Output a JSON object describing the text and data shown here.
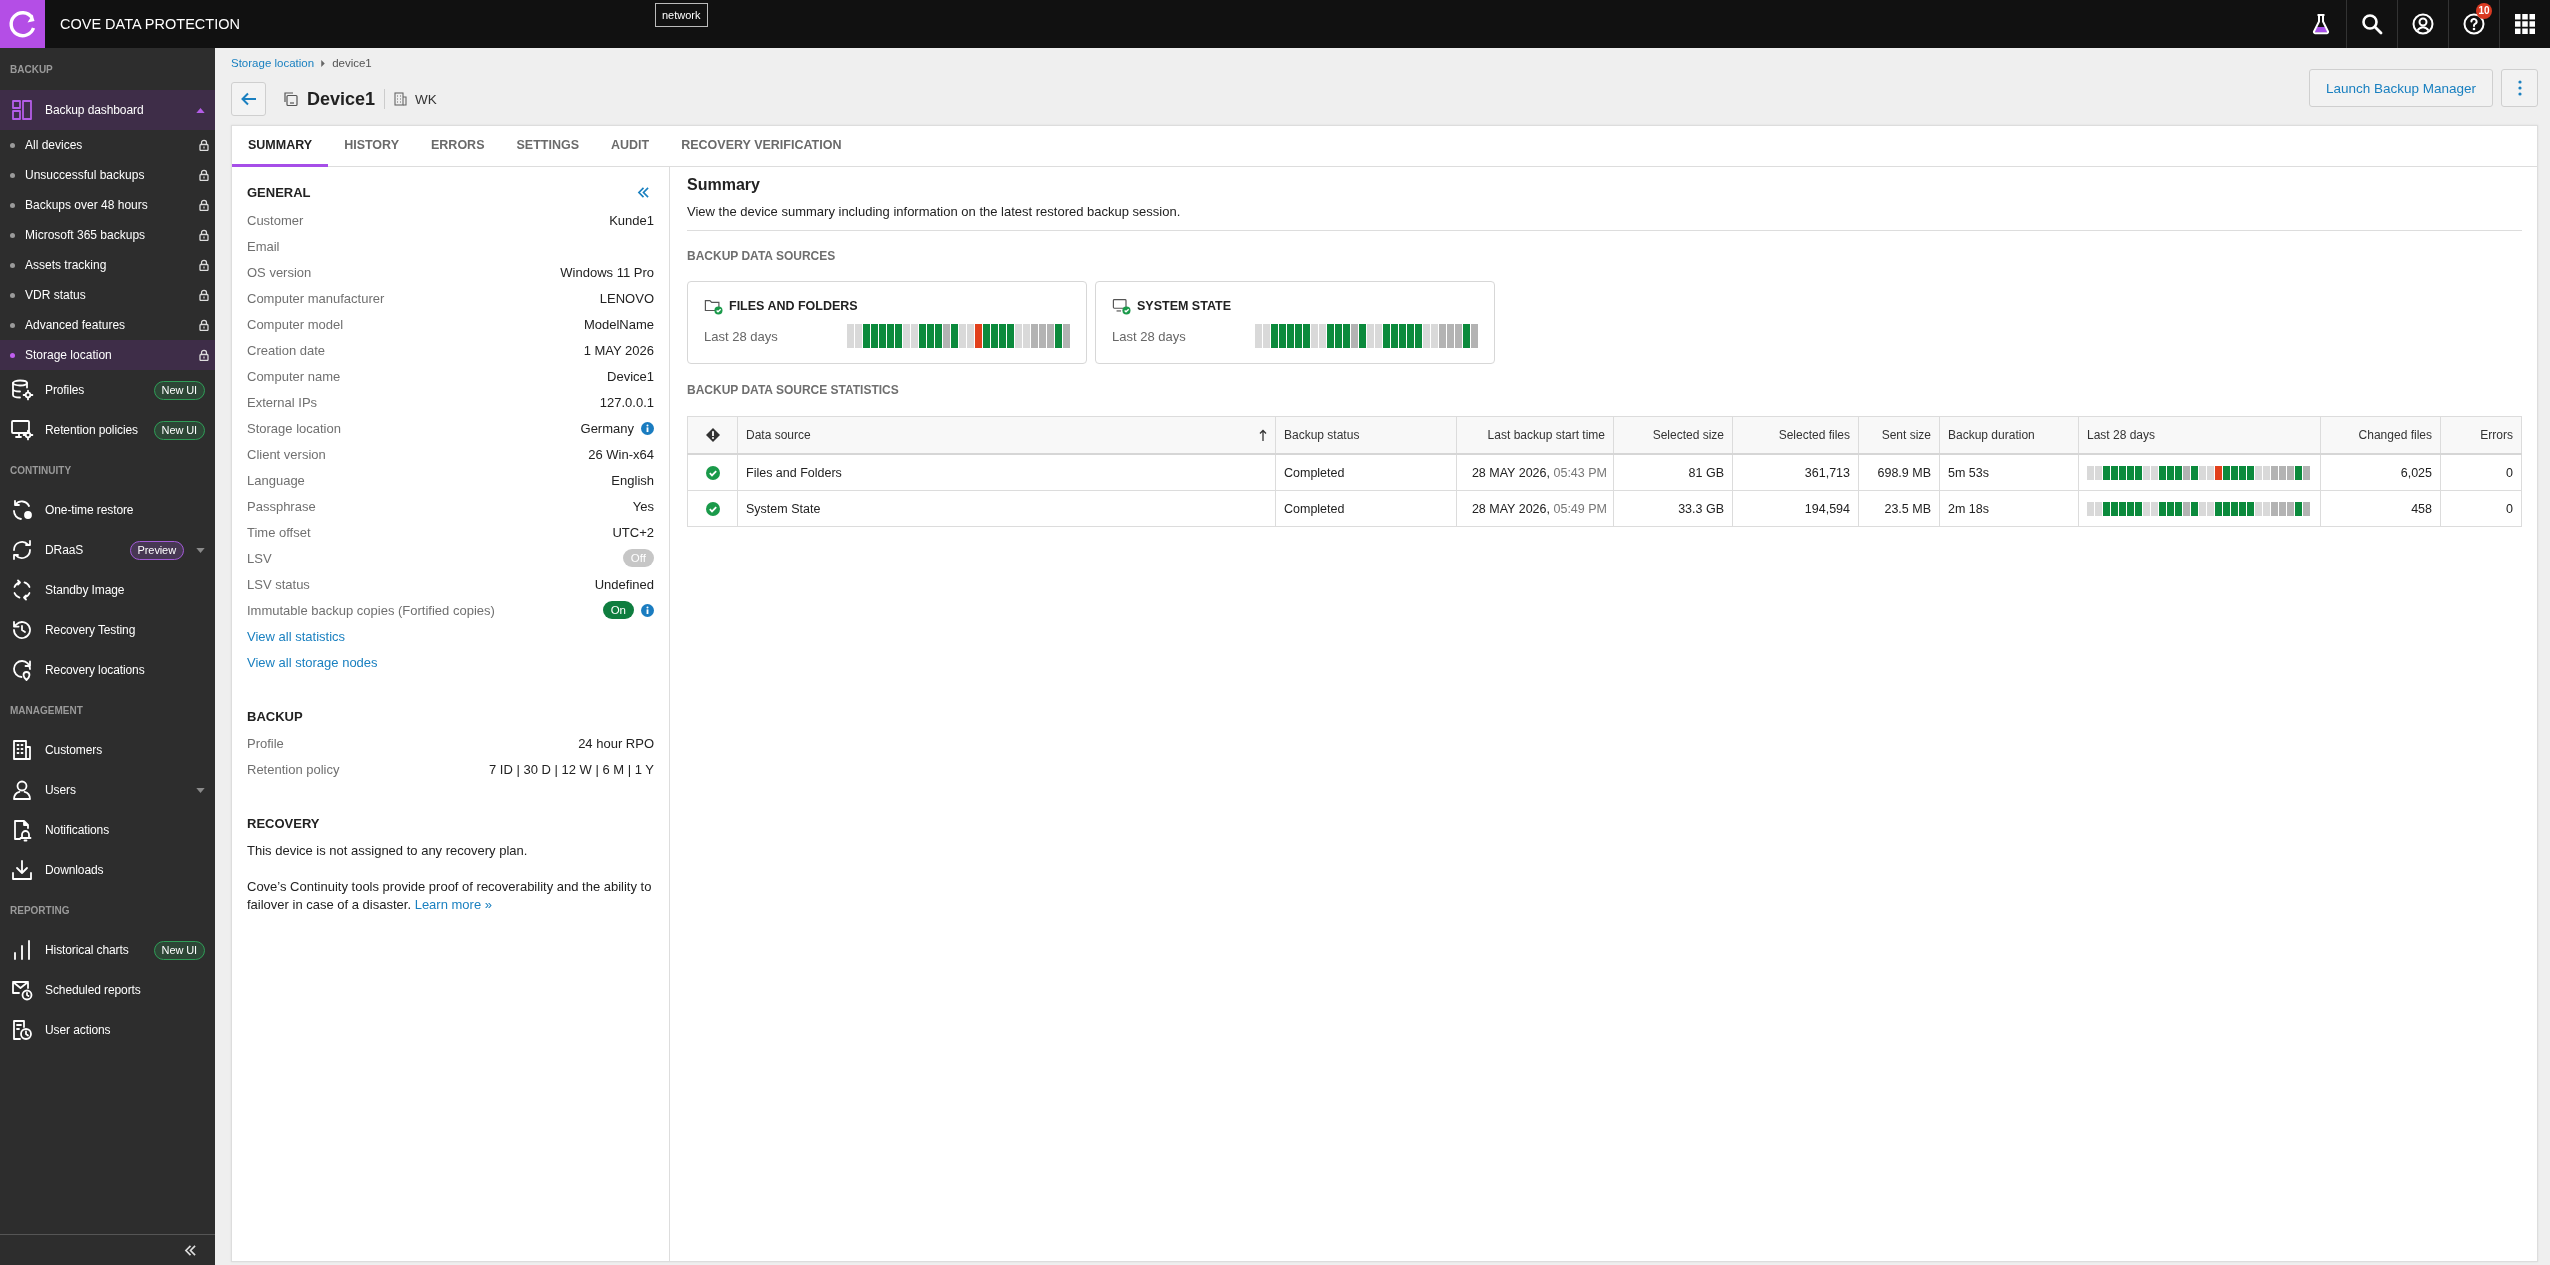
{
  "top_bar": {
    "title": "COVE DATA PROTECTION",
    "environment": "network",
    "help_badge": "10"
  },
  "sidebar": {
    "sections": [
      {
        "heading": "BACKUP",
        "items": [
          {
            "label": "Backup dashboard",
            "selected": true,
            "expanded": true,
            "children": [
              {
                "label": "All devices",
                "selected": false,
                "locked": true
              },
              {
                "label": "Unsuccessful backups",
                "selected": false,
                "locked": true
              },
              {
                "label": "Backups over 48 hours",
                "selected": false,
                "locked": true
              },
              {
                "label": "Microsoft 365 backups",
                "selected": false,
                "locked": true
              },
              {
                "label": "Assets tracking",
                "selected": false,
                "locked": true
              },
              {
                "label": "VDR status",
                "selected": false,
                "locked": true
              },
              {
                "label": "Advanced features",
                "selected": false,
                "locked": true
              },
              {
                "label": "Storage location",
                "selected": true,
                "locked": true
              }
            ]
          },
          {
            "label": "Profiles",
            "selected": false,
            "badge": {
              "label": "New UI",
              "color": "#2f9e57"
            }
          },
          {
            "label": "Retention policies",
            "selected": false,
            "badge": {
              "label": "New UI",
              "color": "#2f9e57"
            }
          }
        ]
      },
      {
        "heading": "CONTINUITY",
        "items": [
          {
            "label": "One-time restore",
            "selected": false
          },
          {
            "label": "DRaaS",
            "selected": false,
            "expanded": false,
            "badge": {
              "label": "Preview",
              "color": "#a35bd8"
            }
          },
          {
            "label": "Standby Image",
            "selected": false
          },
          {
            "label": "Recovery Testing",
            "selected": false
          },
          {
            "label": "Recovery locations",
            "selected": false
          }
        ]
      },
      {
        "heading": "MANAGEMENT",
        "items": [
          {
            "label": "Customers",
            "selected": false
          },
          {
            "label": "Users",
            "selected": false,
            "expanded": false
          },
          {
            "label": "Notifications",
            "selected": false
          },
          {
            "label": "Downloads",
            "selected": false
          }
        ]
      },
      {
        "heading": "REPORTING",
        "items": [
          {
            "label": "Historical charts",
            "selected": false,
            "badge": {
              "label": "New UI",
              "color": "#2f9e57"
            }
          },
          {
            "label": "Scheduled reports",
            "selected": false
          },
          {
            "label": "User actions",
            "selected": false
          }
        ]
      }
    ]
  },
  "page_header": {
    "breadcrumb": {
      "parent": "Storage location",
      "current": "device1"
    },
    "device_name": "Device1",
    "company": "WK",
    "launch_button": "Launch Backup Manager"
  },
  "tabs": [
    {
      "label": "SUMMARY",
      "selected": true
    },
    {
      "label": "HISTORY",
      "selected": false
    },
    {
      "label": "ERRORS",
      "selected": false
    },
    {
      "label": "SETTINGS",
      "selected": false
    },
    {
      "label": "AUDIT",
      "selected": false
    },
    {
      "label": "RECOVERY VERIFICATION",
      "selected": false
    }
  ],
  "general": {
    "heading": "GENERAL",
    "rows": [
      {
        "kind": "text",
        "label": "Customer",
        "value": "Kunde1"
      },
      {
        "kind": "text",
        "label": "Email"
      },
      {
        "kind": "text",
        "label": "OS version",
        "value": "Windows 11 Pro"
      },
      {
        "kind": "text",
        "label": "Computer manufacturer",
        "value": "LENOVO"
      },
      {
        "kind": "text",
        "label": "Computer model",
        "value": "ModelName"
      },
      {
        "kind": "text",
        "label": "Creation date",
        "value": "1 MAY 2026"
      },
      {
        "kind": "text",
        "label": "Computer name",
        "value": "Device1"
      },
      {
        "kind": "text",
        "label": "External IPs",
        "value": "127.0.0.1"
      },
      {
        "kind": "text",
        "label": "Storage location",
        "value": "Germany",
        "info": true
      },
      {
        "kind": "text",
        "label": "Client version",
        "value": "26 Win-x64"
      },
      {
        "kind": "text",
        "label": "Language",
        "value": "English"
      },
      {
        "kind": "text",
        "label": "Passphrase",
        "value": "Yes"
      },
      {
        "kind": "text",
        "label": "Time offset",
        "value": "UTC+2"
      },
      {
        "kind": "toggle",
        "label": "LSV",
        "value": "Off",
        "on": false
      },
      {
        "kind": "text",
        "label": "LSV status",
        "value": "Undefined"
      },
      {
        "kind": "toggle",
        "label": "Immutable backup copies (Fortified copies)",
        "value": "On",
        "on": true,
        "info": true
      }
    ],
    "links": [
      "View all statistics",
      "View all storage nodes"
    ]
  },
  "backup": {
    "heading": "BACKUP",
    "rows": [
      {
        "label": "Profile",
        "value": "24 hour RPO"
      },
      {
        "label": "Retention policy",
        "value": "7 ID | 30 D | 12 W | 6 M | 1 Y"
      }
    ]
  },
  "recovery": {
    "heading": "RECOVERY",
    "note": "This device is not assigned to any recovery plan.",
    "text": "Cove’s Continuity tools provide proof of recoverability and the ability to failover in case of a disaster.",
    "link": "Learn more »"
  },
  "summary": {
    "title": "Summary",
    "description": "View the device summary including information on the latest restored backup session.",
    "sources_heading": "BACKUP DATA SOURCES",
    "sources": [
      {
        "name": "FILES AND FOLDERS",
        "period": "Last 28 days",
        "days": [
          {
            "color": "#d9d9d9"
          },
          {
            "color": "#d9d9d9"
          },
          {
            "color": "#0b8a3c"
          },
          {
            "color": "#0b8a3c"
          },
          {
            "color": "#0b8a3c"
          },
          {
            "color": "#0b8a3c"
          },
          {
            "color": "#0b8a3c"
          },
          {
            "color": "#d9d9d9"
          },
          {
            "color": "#d9d9d9"
          },
          {
            "color": "#0b8a3c"
          },
          {
            "color": "#0b8a3c"
          },
          {
            "color": "#0b8a3c"
          },
          {
            "color": "#b3b3b3"
          },
          {
            "color": "#0b8a3c"
          },
          {
            "color": "#d9d9d9"
          },
          {
            "color": "#d9d9d9"
          },
          {
            "color": "#e2401c"
          },
          {
            "color": "#0b8a3c"
          },
          {
            "color": "#0b8a3c"
          },
          {
            "color": "#0b8a3c"
          },
          {
            "color": "#0b8a3c"
          },
          {
            "color": "#d9d9d9"
          },
          {
            "color": "#d9d9d9"
          },
          {
            "color": "#b3b3b3"
          },
          {
            "color": "#b3b3b3"
          },
          {
            "color": "#b3b3b3"
          },
          {
            "color": "#0b8a3c"
          },
          {
            "color": "#b3b3b3"
          }
        ]
      },
      {
        "name": "SYSTEM STATE",
        "period": "Last 28 days",
        "days": [
          {
            "color": "#d9d9d9"
          },
          {
            "color": "#d9d9d9"
          },
          {
            "color": "#0b8a3c"
          },
          {
            "color": "#0b8a3c"
          },
          {
            "color": "#0b8a3c"
          },
          {
            "color": "#0b8a3c"
          },
          {
            "color": "#0b8a3c"
          },
          {
            "color": "#d9d9d9"
          },
          {
            "color": "#d9d9d9"
          },
          {
            "color": "#0b8a3c"
          },
          {
            "color": "#0b8a3c"
          },
          {
            "color": "#0b8a3c"
          },
          {
            "color": "#b3b3b3"
          },
          {
            "color": "#0b8a3c"
          },
          {
            "color": "#d9d9d9"
          },
          {
            "color": "#d9d9d9"
          },
          {
            "color": "#0b8a3c"
          },
          {
            "color": "#0b8a3c"
          },
          {
            "color": "#0b8a3c"
          },
          {
            "color": "#0b8a3c"
          },
          {
            "color": "#0b8a3c"
          },
          {
            "color": "#d9d9d9"
          },
          {
            "color": "#d9d9d9"
          },
          {
            "color": "#b3b3b3"
          },
          {
            "color": "#b3b3b3"
          },
          {
            "color": "#b3b3b3"
          },
          {
            "color": "#0b8a3c"
          },
          {
            "color": "#b3b3b3"
          }
        ]
      }
    ],
    "statistics_heading": "BACKUP DATA SOURCE STATISTICS"
  },
  "table": {
    "columns": [
      {
        "label": "Data source",
        "sorted": true
      },
      {
        "label": "Backup status",
        "sorted": false
      },
      {
        "label": "Last backup start time",
        "sorted": false
      },
      {
        "label": "Selected size",
        "sorted": false
      },
      {
        "label": "Selected files",
        "sorted": false
      },
      {
        "label": "Sent size",
        "sorted": false
      },
      {
        "label": "Backup duration",
        "sorted": false
      },
      {
        "label": "Last 28 days",
        "sorted": false
      },
      {
        "label": "Changed files",
        "sorted": false
      },
      {
        "label": "Errors",
        "sorted": false
      }
    ],
    "rows": [
      {
        "kind": "success",
        "data_source": "Files and Folders",
        "backup_status": "Completed",
        "start_date": "28 MAY 2026,",
        "start_time": "05:43 PM",
        "selected_size": "81 GB",
        "selected_files": "361,713",
        "sent_size": "698.9 MB",
        "duration": "5m 53s",
        "days": [
          {
            "color": "#d9d9d9"
          },
          {
            "color": "#d9d9d9"
          },
          {
            "color": "#0b8a3c"
          },
          {
            "color": "#0b8a3c"
          },
          {
            "color": "#0b8a3c"
          },
          {
            "color": "#0b8a3c"
          },
          {
            "color": "#0b8a3c"
          },
          {
            "color": "#d9d9d9"
          },
          {
            "color": "#d9d9d9"
          },
          {
            "color": "#0b8a3c"
          },
          {
            "color": "#0b8a3c"
          },
          {
            "color": "#0b8a3c"
          },
          {
            "color": "#b3b3b3"
          },
          {
            "color": "#0b8a3c"
          },
          {
            "color": "#d9d9d9"
          },
          {
            "color": "#d9d9d9"
          },
          {
            "color": "#e2401c"
          },
          {
            "color": "#0b8a3c"
          },
          {
            "color": "#0b8a3c"
          },
          {
            "color": "#0b8a3c"
          },
          {
            "color": "#0b8a3c"
          },
          {
            "color": "#d9d9d9"
          },
          {
            "color": "#d9d9d9"
          },
          {
            "color": "#b3b3b3"
          },
          {
            "color": "#b3b3b3"
          },
          {
            "color": "#b3b3b3"
          },
          {
            "color": "#0b8a3c"
          },
          {
            "color": "#b3b3b3"
          }
        ],
        "changed_files": "6,025",
        "errors": "0"
      },
      {
        "kind": "success",
        "data_source": "System State",
        "backup_status": "Completed",
        "start_date": "28 MAY 2026,",
        "start_time": "05:49 PM",
        "selected_size": "33.3 GB",
        "selected_files": "194,594",
        "sent_size": "23.5 MB",
        "duration": "2m 18s",
        "days": [
          {
            "color": "#d9d9d9"
          },
          {
            "color": "#d9d9d9"
          },
          {
            "color": "#0b8a3c"
          },
          {
            "color": "#0b8a3c"
          },
          {
            "color": "#0b8a3c"
          },
          {
            "color": "#0b8a3c"
          },
          {
            "color": "#0b8a3c"
          },
          {
            "color": "#d9d9d9"
          },
          {
            "color": "#d9d9d9"
          },
          {
            "color": "#0b8a3c"
          },
          {
            "color": "#0b8a3c"
          },
          {
            "color": "#0b8a3c"
          },
          {
            "color": "#b3b3b3"
          },
          {
            "color": "#0b8a3c"
          },
          {
            "color": "#d9d9d9"
          },
          {
            "color": "#d9d9d9"
          },
          {
            "color": "#0b8a3c"
          },
          {
            "color": "#0b8a3c"
          },
          {
            "color": "#0b8a3c"
          },
          {
            "color": "#0b8a3c"
          },
          {
            "color": "#0b8a3c"
          },
          {
            "color": "#d9d9d9"
          },
          {
            "color": "#d9d9d9"
          },
          {
            "color": "#b3b3b3"
          },
          {
            "color": "#b3b3b3"
          },
          {
            "color": "#b3b3b3"
          },
          {
            "color": "#0b8a3c"
          },
          {
            "color": "#b3b3b3"
          }
        ],
        "changed_files": "458",
        "errors": "0"
      }
    ]
  }
}
